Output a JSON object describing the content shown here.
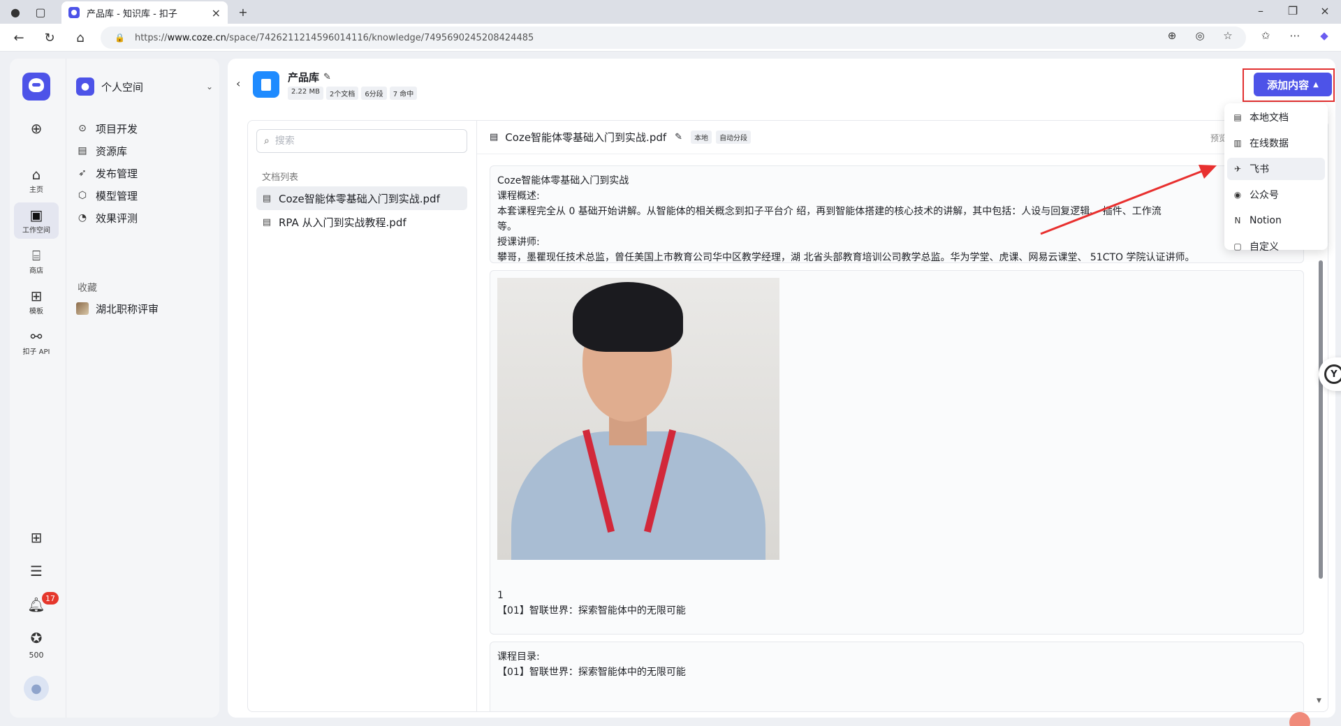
{
  "browser": {
    "tab_title": "产品库 - 知识库 - 扣子",
    "url_prefix": "https://",
    "url_domain": "www.coze.cn",
    "url_path": "/space/7426211214596014116/knowledge/7495690245208424485"
  },
  "rail": {
    "items": [
      {
        "label": "主页",
        "icon": "home-icon"
      },
      {
        "label": "工作空间",
        "icon": "terminal-icon"
      },
      {
        "label": "商店",
        "icon": "store-icon"
      },
      {
        "label": "模板",
        "icon": "template-icon"
      },
      {
        "label": "扣子 API",
        "icon": "api-icon"
      }
    ],
    "notification_count": "17",
    "credits": "500"
  },
  "sidenav": {
    "space_name": "个人空间",
    "items": [
      {
        "label": "项目开发",
        "icon": "project-icon"
      },
      {
        "label": "资源库",
        "icon": "library-icon"
      },
      {
        "label": "发布管理",
        "icon": "rocket-icon"
      },
      {
        "label": "模型管理",
        "icon": "model-icon"
      },
      {
        "label": "效果评测",
        "icon": "evaluate-icon"
      }
    ],
    "favorites_label": "收藏",
    "favorites": [
      {
        "label": "湖北职称评审"
      }
    ]
  },
  "knowledge": {
    "title": "产品库",
    "tags": [
      "2.22 MB",
      "2个文档",
      "6分段",
      "7 命中"
    ],
    "add_button": "添加内容",
    "search_placeholder": "搜索",
    "list_label": "文档列表",
    "docs": [
      {
        "name": "Coze智能体零基础入门到实战.pdf"
      },
      {
        "name": "RPA 从入门到实战教程.pdf"
      }
    ]
  },
  "document": {
    "name": "Coze智能体零基础入门到实战.pdf",
    "tags": [
      "本地",
      "自动分段"
    ],
    "preview_label": "预览原始文",
    "chunk1": [
      "Coze智能体零基础入门到实战",
      "课程概述:",
      "本套课程完全从 0 基础开始讲解。从智能体的相关概念到扣子平台介 绍，再到智能体搭建的核心技术的讲解，其中包括：人设与回复逻辑、 插件、工作流",
      "等。",
      "授课讲师:",
      "攀哥，墨瞿现任技术总监，曾任美国上市教育公司华中区教学经理，湖 北省头部教育培训公司教学总监。华为学堂、虎课、网易云课堂、 51CTO 学院认证讲师。"
    ],
    "chunk2": [
      "1",
      "【01】智联世界：探索智能体中的无限可能"
    ],
    "chunk3": [
      "课程目录:",
      "【01】智联世界：探索智能体中的无限可能"
    ]
  },
  "dropdown": {
    "items": [
      {
        "label": "本地文档",
        "icon": "file-icon"
      },
      {
        "label": "在线数据",
        "icon": "web-file-icon"
      },
      {
        "label": "飞书",
        "icon": "feishu-icon"
      },
      {
        "label": "公众号",
        "icon": "wechat-icon"
      },
      {
        "label": "Notion",
        "icon": "notion-icon"
      },
      {
        "label": "自定义",
        "icon": "custom-file-icon"
      }
    ]
  },
  "colors": {
    "accent": "#4d53e8",
    "highlight_box": "#e22f2f",
    "annotation_arrow": "#e8302f"
  }
}
